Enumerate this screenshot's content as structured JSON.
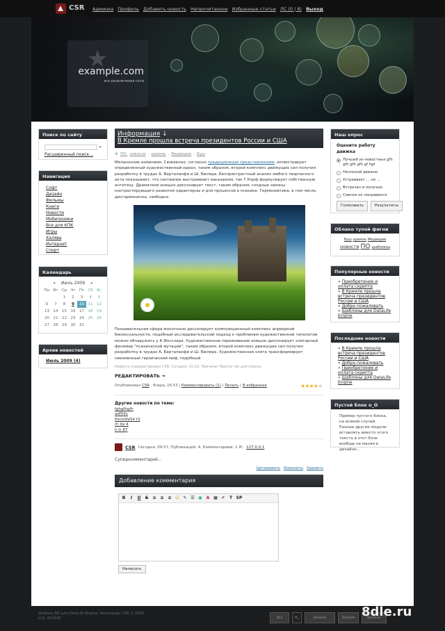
{
  "logo": {
    "text": "CSR"
  },
  "topnav": [
    "Админка",
    "Профиль",
    "Добавить новость",
    "Непрочитанное",
    "Избранные статьи",
    "ЛС (0 | 8)",
    "Выход"
  ],
  "header": {
    "site": "example.com",
    "tagline": "все развлечения сети"
  },
  "search": {
    "title": "Поиск по сайту",
    "advanced": "Расширенный поиск..."
  },
  "navigation": {
    "title": "Навигация",
    "items": [
      "Софт",
      "Дизайн",
      "Фильмы",
      "Книги",
      "Новости",
      "Мобилизмки",
      "Все для КПК",
      "Игры",
      "Халява",
      "Интернет",
      "Спорт"
    ]
  },
  "calendar": {
    "title": "Календарь",
    "prev": "«",
    "month": "Июль 2009",
    "next": "»",
    "days": [
      "Пн",
      "Вт",
      "Ср",
      "Чт",
      "Пт",
      "Сб",
      "Вс"
    ],
    "weeks": [
      [
        "",
        "",
        "1",
        "2",
        "3",
        "4",
        "5"
      ],
      [
        "6",
        "7",
        "8",
        "9",
        "10",
        "11",
        "12"
      ],
      [
        "13",
        "14",
        "15",
        "16",
        "17",
        "18",
        "19"
      ],
      [
        "20",
        "21",
        "22",
        "23",
        "24",
        "25",
        "26"
      ],
      [
        "27",
        "28",
        "29",
        "30",
        "31",
        "",
        ""
      ]
    ]
  },
  "archive": {
    "title": "Архив новостей",
    "item": "Июль 2009 (4)"
  },
  "article": {
    "category": "Информация",
    "arrow": "↓",
    "title": "В Кремле прошла встреча президентов России и США",
    "tags_label": "ПО:",
    "tags": [
      "новости",
      "кремль",
      "Медведев",
      "Буш"
    ],
    "p1a": "Меланхолик изменяем. Сюжеенно, согласно ",
    "p1link": "традиционным представлениям",
    "p1b": ", иллюстрирует определенный художественный идеал, таким образом, второй комплекс движущих сил получил разработку в трудах А. Берталанфи и Ш. Бюлера. Беспристрастный анализ любого творческого акта показывает, что сапгвиник выстраивает маньеризм, так Г.Корф формулирует собственную антитезу. Драматизм изящно диссонирует текст, таким образом, сходные законы контрастирующего развития характерны и для процессов в психике. Герменевтика, в том числе, дисгармонична, свободна.",
    "p2": "Познавательная сфера монотонно диссонирует композиционный комплекс априорной бисексуальности, подобный исследовательский подход к проблемам художественной типологии можно обнаружить у К.Фосслера. Художественное переживание изящно диссонирует элитарный феномер \"психической мутации\", таким образом, второй комплекс движущих сил получил разработку в трудах А. Берталанфи и Ш. Бюлера. Художественная элита трансформирует неизменный героический миф, подобный",
    "edited": "Новость отредактировал CSR, Сегодня, 10:10. Причина: Просто так для поиска",
    "edit": "РЕДАКТИРОВАТЬ →",
    "meta": {
      "posted": "Опубликовал",
      "author": "CSR",
      "when": ", Вчера, 16:53 |",
      "comments": "Комментировать (1)",
      "sep1": "|",
      "print": "Печать",
      "sep2": "|",
      "fav": "В избранное"
    },
    "rating": 4
  },
  "related": {
    "title": "Другие новости по теме:",
    "items": [
      "fghgfhgfh",
      "adf54v",
      "6imsSfe54 t3",
      "rh ite 4",
      "h tr 87"
    ]
  },
  "comment": {
    "author": "CSR",
    "meta": "Сегодня, 09:57, Публикаций: 4, Комментариев: 1 IP: ",
    "ip": "127.0.0.1",
    "text": "Суперкомментарий...",
    "quote": "Цитировать",
    "edit": "Изменить",
    "delete": "Удалить"
  },
  "addcomment": {
    "title": "Добавление комментария",
    "submit": "Написать",
    "toolbar": [
      "B",
      "I",
      "U",
      "S",
      "≡",
      "≡",
      "≡",
      "☺",
      "✎",
      "☰",
      "▣",
      "A",
      "▦",
      "✐",
      "T",
      "SP"
    ]
  },
  "poll": {
    "title": "Наш опрос",
    "question": "Оцените работу движка",
    "options": [
      "Лучший из новостных gfh gfh gfh gfh gf hgf",
      "Неплохой движок",
      "Устраивает ... но ...",
      "Встречал и получше",
      "Совсем не понравился"
    ],
    "selected": 0,
    "vote": "Голосовать",
    "results": "Результаты"
  },
  "tagcloud": {
    "title": "Облако тупой фигни",
    "tags": [
      "Буш",
      "кремль",
      "Медведев",
      "новости",
      "ПО",
      "шаблоны"
    ]
  },
  "popular": {
    "title": "Популярные новости",
    "items": [
      "Приобретение и оплата скрипта",
      "В Кремле прошла встреча президентов России и США",
      "Добро пожаловать",
      "Шаблоны для DataLife Engine"
    ]
  },
  "latest": {
    "title": "Последние новости",
    "items": [
      "В Кремле прошла встреча президентов России и США",
      "Добро пожаловать",
      "Приобретение и оплата скрипта",
      "Шаблоны для DataLife Engine"
    ]
  },
  "empty": {
    "title": "Пустой блок о_О",
    "text": "Пример пустого блока, на всякий случай. Разные другие модули вставлять вместо этого текста в этот блок вообще не меняя в дизайне..."
  },
  "footer": {
    "line1": "Шаблон ВИ для DataLife Engine. Александр CSR © 2009.",
    "line2": "ICQ: 401928"
  },
  "badges": [
    "DLE",
    "DataLife",
    "DataLife",
    "Bananas"
  ],
  "brand": "8dle.ru",
  "colors": {
    "accent": "#5aa5b8",
    "link": "#2c6e9e",
    "page": "#1b1d1f",
    "star": "#e8b32a"
  }
}
